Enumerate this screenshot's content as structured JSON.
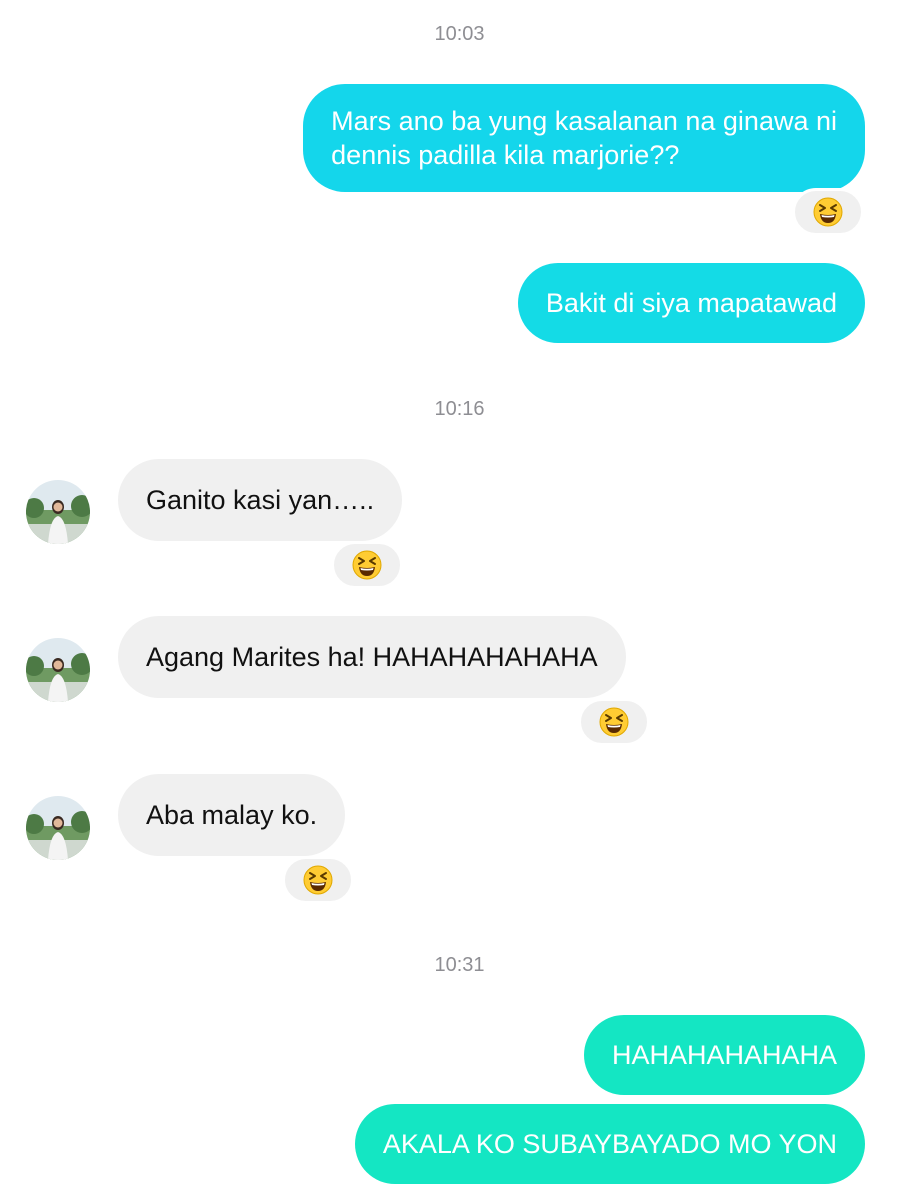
{
  "colors": {
    "sent_cyan": "#14d6eb",
    "sent_cyan_alt": "#14dbe6",
    "sent_mint": "#14e6c3",
    "received_bg": "#f0f0f0",
    "timestamp": "#8e8e93"
  },
  "conversation": {
    "timestamps": [
      "10:03",
      "10:16",
      "10:31"
    ],
    "messages": [
      {
        "direction": "outgoing",
        "lines": [
          "Mars ano ba yung kasalanan na ginawa ni",
          "dennis padilla kila marjorie??"
        ],
        "reaction": "laughing-squint-emoji"
      },
      {
        "direction": "outgoing",
        "text": "Bakit di siya mapatawad"
      },
      {
        "direction": "incoming",
        "text": "Ganito kasi yan…..",
        "reaction": "laughing-squint-emoji"
      },
      {
        "direction": "incoming",
        "text": "Agang Marites ha! HAHAHAHAHAHA",
        "reaction": "laughing-squint-emoji"
      },
      {
        "direction": "incoming",
        "text": "Aba malay ko.",
        "reaction": "laughing-squint-emoji"
      },
      {
        "direction": "outgoing",
        "text": "HAHAHAHAHAHA"
      },
      {
        "direction": "outgoing",
        "text": "AKALA KO SUBAYBAYADO MO YON"
      }
    ]
  }
}
